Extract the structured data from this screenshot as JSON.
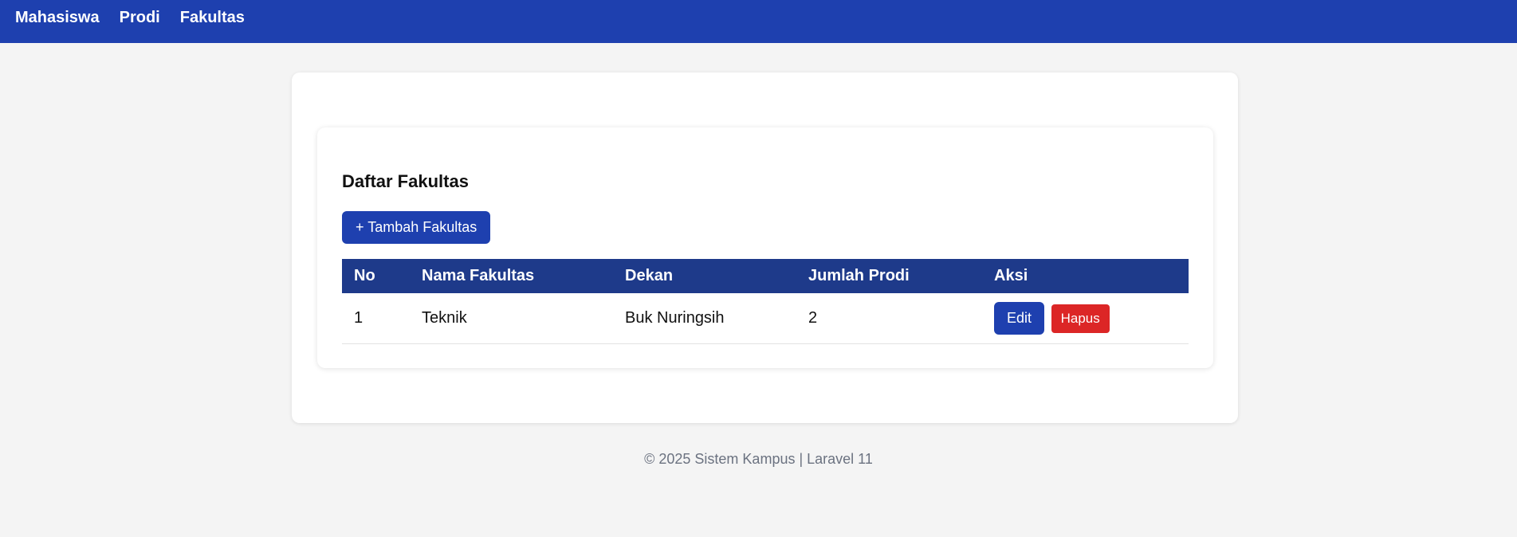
{
  "nav": {
    "items": [
      {
        "label": "Mahasiswa"
      },
      {
        "label": "Prodi"
      },
      {
        "label": "Fakultas"
      }
    ]
  },
  "page": {
    "title": "Daftar Fakultas",
    "add_button_label": "+ Tambah Fakultas"
  },
  "table": {
    "headers": [
      "No",
      "Nama Fakultas",
      "Dekan",
      "Jumlah Prodi",
      "Aksi"
    ],
    "rows": [
      {
        "no": "1",
        "nama_fakultas": "Teknik",
        "dekan": "Buk Nuringsih",
        "jumlah_prodi": "2",
        "actions": {
          "edit_label": "Edit",
          "delete_label": "Hapus"
        }
      }
    ]
  },
  "footer": {
    "text": "© 2025 Sistem Kampus | Laravel 11"
  },
  "colors": {
    "navbar": "#1e40af",
    "table_header": "#1e3a8a",
    "primary_button": "#1e40af",
    "danger_button": "#dc2626",
    "background": "#f4f4f4"
  }
}
